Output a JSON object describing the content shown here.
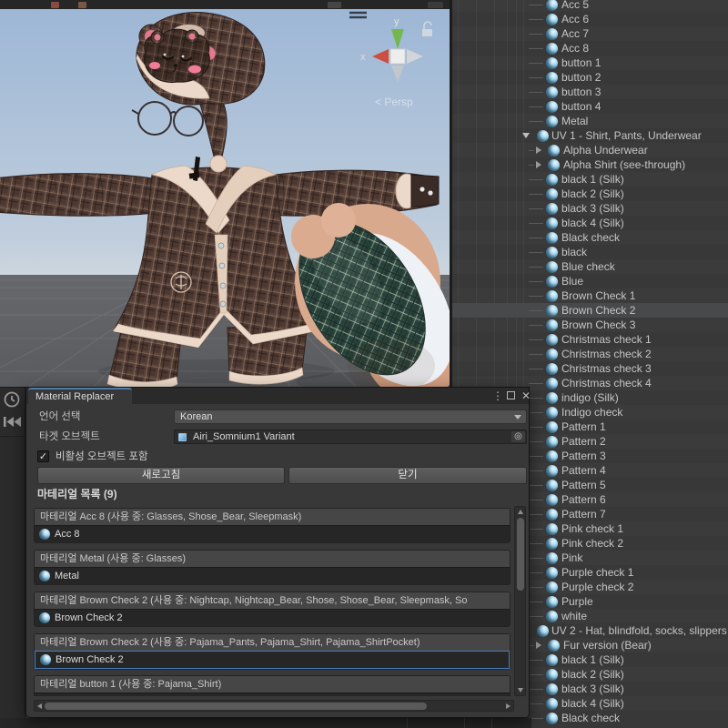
{
  "colors": {
    "panel_bg": "#383838",
    "selection_row": "#48494b",
    "tab_accent": "#4f7ca8",
    "material_icon_blue": "#a5d8f0",
    "field_selected_border": "#4a7fc1",
    "sky_top": "#9db7d6",
    "sky_horizon": "#c9d3dc",
    "ground": "#5f6265"
  },
  "scene": {
    "persp_label": "< Persp",
    "gizmo": {
      "x_label": "x",
      "y_label": "y"
    }
  },
  "window": {
    "tab_title": "Material Replacer",
    "controls": {
      "menu": "⋮",
      "close": "✕"
    },
    "language_label": "언어 선택",
    "language_value": "Korean",
    "target_label": "타겟 오브젝트",
    "target_value": "Airi_Somnium1 Variant",
    "target_picker": "◎",
    "include_inactive_label": "비활성 오브젝트 포함",
    "include_inactive_checked": true,
    "checkmark": "✓",
    "refresh_button": "새로고침",
    "close_button": "닫기",
    "section_title": "마테리얼 목록 (9)",
    "materials": [
      {
        "header": "마테리얼 Acc 8 (사용 중: Glasses, Shose_Bear, Sleepmask)",
        "value": "Acc 8",
        "selected": false
      },
      {
        "header": "마테리얼 Metal (사용 중: Glasses)",
        "value": "Metal",
        "selected": false
      },
      {
        "header": "마테리얼 Brown Check 2 (사용 중: Nightcap, Nightcap_Bear, Shose, Shose_Bear, Sleepmask, So",
        "value": "Brown Check 2",
        "selected": false
      },
      {
        "header": "마테리얼 Brown Check 2 (사용 중: Pajama_Pants, Pajama_Shirt, Pajama_ShirtPocket)",
        "value": "Brown Check 2",
        "selected": true
      },
      {
        "header": "마테리얼 button 1 (사용 중: Pajama_Shirt)",
        "value": "",
        "selected": false
      }
    ]
  },
  "hierarchy": {
    "items": [
      {
        "label": "Acc 5",
        "kind": "item"
      },
      {
        "label": "Acc 6",
        "kind": "item"
      },
      {
        "label": "Acc 7",
        "kind": "item"
      },
      {
        "label": "Acc 8",
        "kind": "item"
      },
      {
        "label": "button 1",
        "kind": "item"
      },
      {
        "label": "button 2",
        "kind": "item"
      },
      {
        "label": "button 3",
        "kind": "item"
      },
      {
        "label": "button 4",
        "kind": "item"
      },
      {
        "label": "Metal",
        "kind": "item"
      },
      {
        "label": "UV 1 - Shirt, Pants, Underwear",
        "kind": "parent"
      },
      {
        "label": "Alpha  Underwear",
        "kind": "child"
      },
      {
        "label": "Alpha Shirt  (see-through)",
        "kind": "child"
      },
      {
        "label": "black 1 (Silk)",
        "kind": "item"
      },
      {
        "label": "black 2 (Silk)",
        "kind": "item"
      },
      {
        "label": "black 3 (Silk)",
        "kind": "item"
      },
      {
        "label": "black 4 (Silk)",
        "kind": "item"
      },
      {
        "label": "Black check",
        "kind": "item"
      },
      {
        "label": "black",
        "kind": "item"
      },
      {
        "label": "Blue check",
        "kind": "item"
      },
      {
        "label": "Blue",
        "kind": "item"
      },
      {
        "label": "Brown Check 1",
        "kind": "item"
      },
      {
        "label": "Brown Check 2",
        "kind": "item",
        "selected": true
      },
      {
        "label": "Brown Check 3",
        "kind": "item"
      },
      {
        "label": "Christmas check 1",
        "kind": "item"
      },
      {
        "label": "Christmas check 2",
        "kind": "item"
      },
      {
        "label": "Christmas check 3",
        "kind": "item"
      },
      {
        "label": "Christmas check 4",
        "kind": "item"
      },
      {
        "label": "indigo (Silk)",
        "kind": "item"
      },
      {
        "label": "Indigo check",
        "kind": "item"
      },
      {
        "label": "Pattern 1",
        "kind": "item"
      },
      {
        "label": "Pattern 2",
        "kind": "item"
      },
      {
        "label": "Pattern 3",
        "kind": "item"
      },
      {
        "label": "Pattern 4",
        "kind": "item"
      },
      {
        "label": "Pattern 5",
        "kind": "item"
      },
      {
        "label": "Pattern 6",
        "kind": "item"
      },
      {
        "label": "Pattern 7",
        "kind": "item"
      },
      {
        "label": "Pink check 1",
        "kind": "item"
      },
      {
        "label": "Pink check 2",
        "kind": "item"
      },
      {
        "label": "Pink",
        "kind": "item"
      },
      {
        "label": "Purple check 1",
        "kind": "item"
      },
      {
        "label": "Purple check 2",
        "kind": "item"
      },
      {
        "label": "Purple",
        "kind": "item"
      },
      {
        "label": "white",
        "kind": "item"
      },
      {
        "label": "UV 2 - Hat, blindfold, socks, slippers",
        "kind": "parent"
      },
      {
        "label": "Fur version (Bear)",
        "kind": "child"
      },
      {
        "label": "black 1 (Silk)",
        "kind": "item"
      },
      {
        "label": "black 2 (Silk)",
        "kind": "item"
      },
      {
        "label": "black 3 (Silk)",
        "kind": "item"
      },
      {
        "label": "black 4 (Silk)",
        "kind": "item"
      },
      {
        "label": "Black check",
        "kind": "item"
      }
    ]
  }
}
